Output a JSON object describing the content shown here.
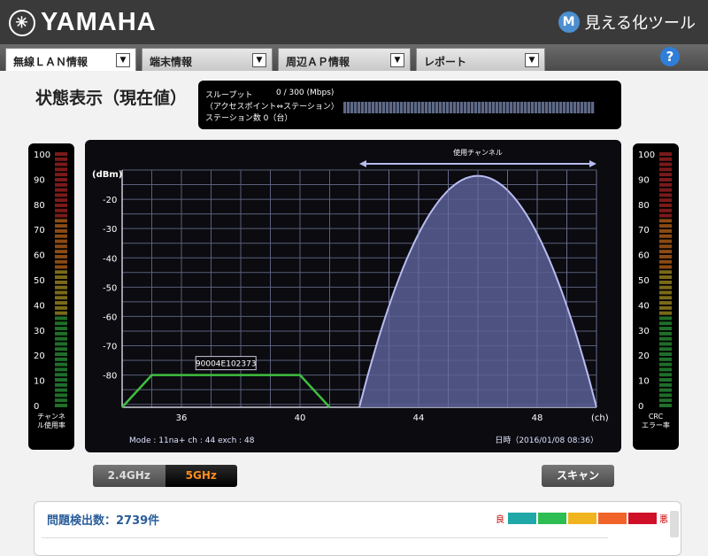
{
  "header": {
    "brand": "YAMAHA",
    "app_title": "見える化ツール"
  },
  "tabs": [
    {
      "label": "無線ＬＡＮ情報",
      "active": true
    },
    {
      "label": "端末情報",
      "active": false
    },
    {
      "label": "周辺ＡＰ情報",
      "active": false
    },
    {
      "label": "レポート",
      "active": false
    }
  ],
  "help_label": "?",
  "status_title": "状態表示（現在値）",
  "throughput": {
    "label": "スループット",
    "value": "0 / 300 (Mbps)",
    "sublabel": "（アクセスポイント⇔ステーション）",
    "station_count": "ステーション数  0（台）"
  },
  "left_meter": {
    "ticks": [
      "100",
      "90",
      "80",
      "70",
      "60",
      "50",
      "40",
      "30",
      "20",
      "10",
      "0"
    ],
    "label_line1": "チャンネ",
    "label_line2": "ル使用率",
    "value_percent": 0
  },
  "right_meter": {
    "ticks": [
      "100",
      "90",
      "80",
      "70",
      "60",
      "50",
      "40",
      "30",
      "20",
      "10",
      "0"
    ],
    "label_line1": "CRC",
    "label_line2": "エラー率",
    "value_percent": 0
  },
  "chart_data": {
    "type": "area",
    "ylabel": "(dBm)",
    "xlabel": "(ch)",
    "yticks": [
      "-20",
      "-30",
      "-40",
      "-50",
      "-60",
      "-70",
      "-80"
    ],
    "ylim": [
      -91,
      -10
    ],
    "xlim": [
      34,
      50
    ],
    "xticks": [
      36,
      40,
      44,
      48
    ],
    "channel_band_label": "使用チャンネル",
    "channel_band": [
      42,
      50
    ],
    "series": [
      {
        "name": "90004E102373",
        "color": "#3fbf3f",
        "points": [
          [
            34,
            -91
          ],
          [
            35,
            -80
          ],
          [
            40,
            -80
          ],
          [
            41,
            -91
          ]
        ]
      },
      {
        "name": "",
        "color": "#b8bcf0",
        "fill": "#5a5f94",
        "peak_channel": 46,
        "peak_value": -12,
        "range": [
          42,
          50
        ],
        "floor": -91
      }
    ]
  },
  "chart_info": {
    "mode": "Mode : 11na+   ch : 44   exch : 48",
    "datetime": "日時（2016/01/08 08:36）"
  },
  "band_buttons": {
    "b24": "2.4GHz",
    "b5": "5GHz"
  },
  "scan_label": "スキャン",
  "problems": {
    "title": "問題検出数：2739件",
    "good": "良",
    "bad": "悪",
    "colors": [
      "#20a8a8",
      "#2dbd52",
      "#f0b41e",
      "#f0642a",
      "#d01028"
    ]
  }
}
